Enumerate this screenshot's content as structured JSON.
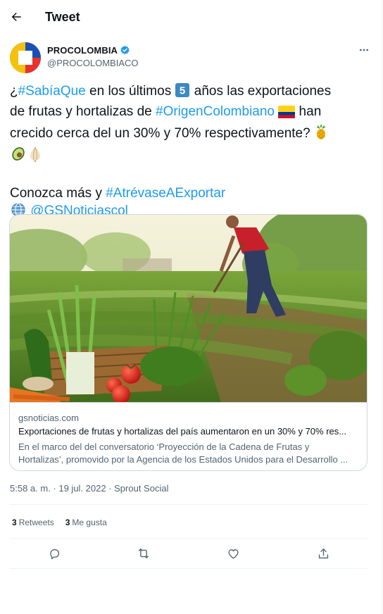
{
  "header": {
    "title": "Tweet"
  },
  "author": {
    "display_name": "PROCOLOMBIA",
    "handle": "@PROCOLOMBIACO",
    "verified": true,
    "avatar_colors": [
      "#f4c20d",
      "#e8322c",
      "#1a4fb4",
      "#ffffff"
    ]
  },
  "tweet": {
    "line1": {
      "pre": "¿",
      "hashtag1": "#SabíaQue",
      "mid": " en los últimos ",
      "number_emoji": "5",
      "post": " años las exportaciones"
    },
    "line2": {
      "pre": "de frutas y hortalizas de ",
      "hashtag2": "#OrigenColombiano",
      "post": " han"
    },
    "line3": {
      "text": "crecido cerca del un 30% y 70% respectivamente?"
    },
    "line5": {
      "pre": "Conozca más y ",
      "hashtag3": "#AtrévaseAExportar"
    },
    "line6": {
      "mention": "@GSNoticiascol"
    },
    "emoji_icons": [
      "pineapple-icon",
      "avocado-icon",
      "onion-icon",
      "colombia-flag-icon",
      "globe-icon"
    ]
  },
  "card": {
    "domain": "gsnoticias.com",
    "title": "Exportaciones de frutas y hortalizas del país aumentaron en un 30% y 70% res...",
    "desc_line1": "En el marco del del conversatorio ‘Proyección de la Cadena de Frutas y",
    "desc_line2": "Hortalizas’, promovido por la Agencia de los Estados Unidos para el Desarrollo ..."
  },
  "meta": {
    "timestamp": "5:58 a. m. · 19 jul. 2022 · Sprout Social"
  },
  "stats": {
    "retweets_count": "3",
    "retweets_label": "Retweets",
    "likes_count": "3",
    "likes_label": "Me gusta"
  },
  "colors": {
    "link": "#1d9bf0",
    "text": "#0f1419",
    "secondary": "#536471",
    "border": "#cfd9de"
  }
}
